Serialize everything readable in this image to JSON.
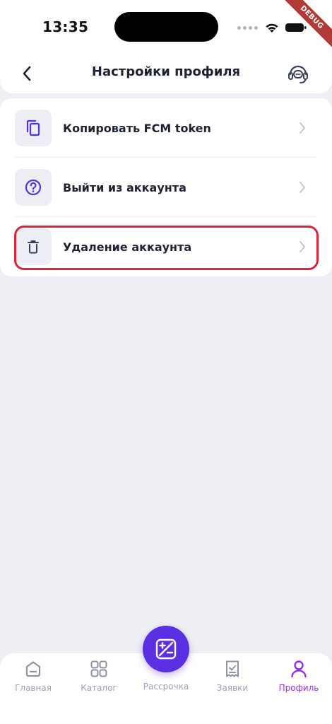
{
  "status_bar": {
    "time": "13:35",
    "debug_banner": "DEBUG"
  },
  "header": {
    "title": "Настройки профиля",
    "back_icon": "chevron-left-icon",
    "support_icon": "headset-icon"
  },
  "settings": {
    "items": [
      {
        "label": "Копировать FCM token",
        "icon": "copy-icon"
      },
      {
        "label": "Выйти из аккаунта",
        "icon": "question-circle-icon"
      },
      {
        "label": "Удаление аккаунта",
        "icon": "trash-icon",
        "highlighted": true
      }
    ]
  },
  "bottom_nav": {
    "items": [
      {
        "label": "Главная",
        "icon": "home-icon"
      },
      {
        "label": "Каталог",
        "icon": "grid-icon"
      },
      {
        "label": "Рассрочка",
        "icon": "installment-icon"
      },
      {
        "label": "Заявки",
        "icon": "receipt-icon"
      },
      {
        "label": "Профиль",
        "icon": "user-icon",
        "active": true
      }
    ]
  },
  "colors": {
    "accent": "#5b30e3",
    "active_tab": "#9a2ff0",
    "highlight_border": "#d8253a",
    "background": "#edeff4"
  }
}
